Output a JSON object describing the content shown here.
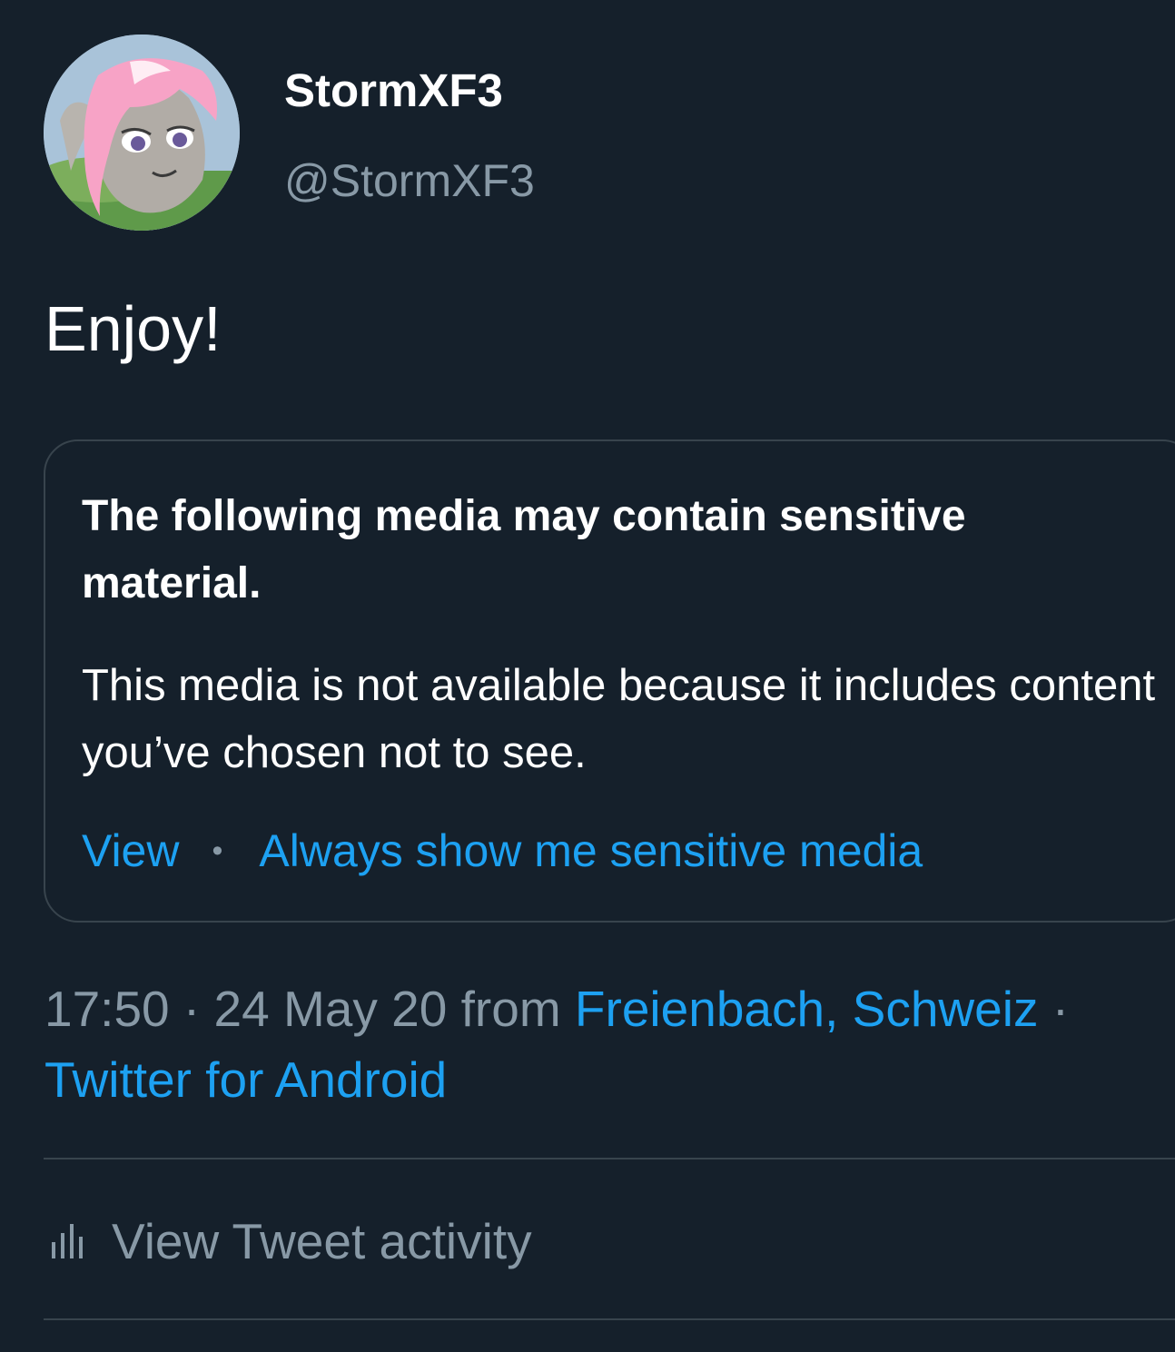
{
  "tweet": {
    "author": {
      "display_name": "StormXF3",
      "handle": "@StormXF3"
    },
    "text": "Enjoy!"
  },
  "sensitive_notice": {
    "title": "The following media may contain sensitive material.",
    "body": "This media is not available because it includes content you’ve chosen not to see.",
    "view_label": "View",
    "separator": "•",
    "always_show_label": "Always show me sensitive media"
  },
  "meta": {
    "time": "17:50",
    "sep1": " · ",
    "date": "24 May 20",
    "from_label": " from ",
    "location": "Freienbach, Schweiz",
    "sep2": " · ",
    "source": "Twitter for Android"
  },
  "activity": {
    "label": "View Tweet activity",
    "icon": "bar-chart-icon"
  },
  "colors": {
    "background": "#15202b",
    "link": "#1da1f2",
    "secondary_text": "#8899a6",
    "border": "#38444d"
  }
}
